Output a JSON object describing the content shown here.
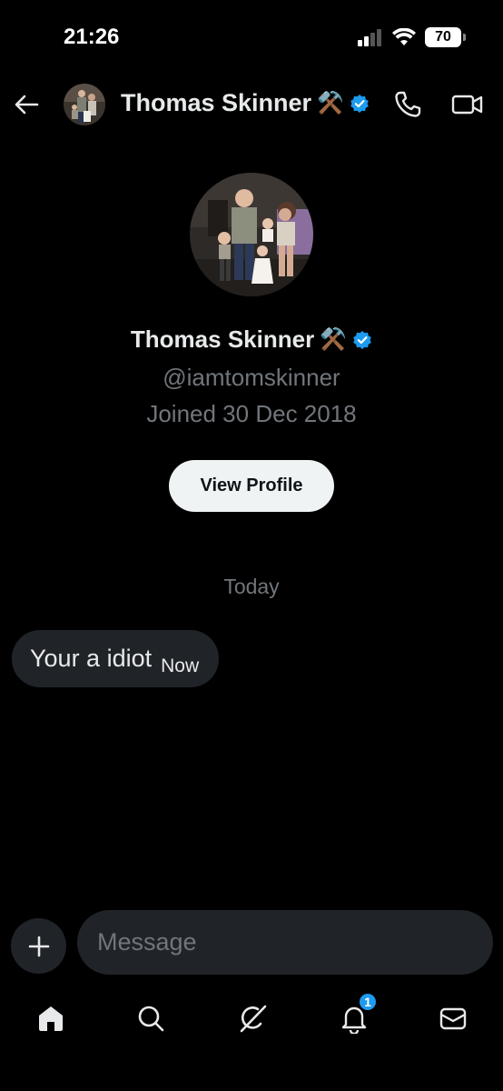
{
  "status_bar": {
    "time": "21:26",
    "battery": "70",
    "icons": [
      "signal-icon",
      "wifi-icon",
      "battery-icon"
    ]
  },
  "header": {
    "name": "Thomas Skinner",
    "emoji": "⚒️",
    "verified": true,
    "icons": [
      "back-arrow-icon",
      "avatar",
      "verified-badge-icon",
      "phone-icon",
      "video-icon"
    ]
  },
  "profile": {
    "name": "Thomas Skinner",
    "emoji": "⚒️",
    "handle": "@iamtomskinner",
    "joined": "Joined 30 Dec 2018",
    "view_profile_label": "View Profile"
  },
  "conversation": {
    "date_separator": "Today",
    "messages": [
      {
        "text": "Your a idiot",
        "time": "Now"
      }
    ]
  },
  "composer": {
    "placeholder": "Message",
    "value": ""
  },
  "bottom_nav": {
    "items": [
      "home-icon",
      "search-icon",
      "grok-icon",
      "notifications-icon",
      "messages-icon"
    ],
    "notification_count": "1"
  },
  "colors": {
    "background": "#000000",
    "accent": "#1d9bf0",
    "bubble": "#202327",
    "muted_text": "#71767b",
    "primary_text": "#e7e9ea"
  }
}
